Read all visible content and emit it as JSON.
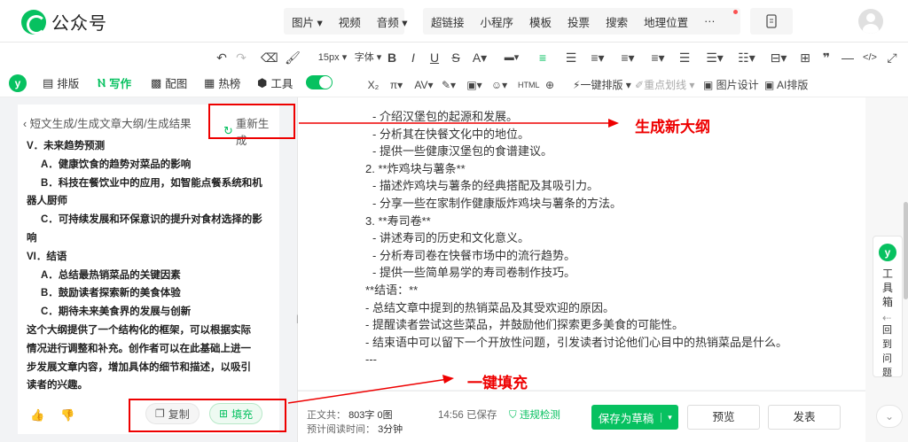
{
  "app": {
    "title": "公众号"
  },
  "topmenu": {
    "group1": [
      "图片",
      "视频",
      "音频"
    ],
    "group2": [
      "超链接",
      "小程序",
      "模板",
      "投票",
      "搜索",
      "地理位置",
      "···"
    ]
  },
  "toolbar": {
    "font_size": "15px",
    "font_family": "字体",
    "one_click": "一键排版",
    "highlight": "重点划线",
    "image_design": "图片设计",
    "ai_layout": "AI排版"
  },
  "nav": {
    "tabs": [
      {
        "label": "排版",
        "icon": "layout-icon"
      },
      {
        "label": "写作",
        "icon": "write-icon",
        "active": true
      },
      {
        "label": "配图",
        "icon": "image-icon"
      },
      {
        "label": "热榜",
        "icon": "hot-icon"
      },
      {
        "label": "工具",
        "icon": "tool-icon"
      }
    ]
  },
  "panel": {
    "breadcrumb": "短文生成/生成文章大纲/生成结果",
    "regenerate": "重新生成",
    "lines": [
      {
        "text": "V．未来趋势预测",
        "indent": false
      },
      {
        "text": "A．健康饮食的趋势对菜品的影响",
        "indent": true
      },
      {
        "text": "B．科技在餐饮业中的应用，如智能点餐系统和机",
        "indent": true
      },
      {
        "text": "器人厨师",
        "indent": false
      },
      {
        "text": "C．可持续发展和环保意识的提升对食材选择的影",
        "indent": true
      },
      {
        "text": "响",
        "indent": false
      },
      {
        "text": "VI．结语",
        "indent": false
      },
      {
        "text": "A．总结最热销菜品的关键因素",
        "indent": true
      },
      {
        "text": "B．鼓励读者探索新的美食体验",
        "indent": true
      },
      {
        "text": "C．期待未来美食界的发展与创新",
        "indent": true
      },
      {
        "text": "这个大纲提供了一个结构化的框架，可以根据实际",
        "indent": false
      },
      {
        "text": "情况进行调整和补充。创作者可以在此基础上进一",
        "indent": false
      },
      {
        "text": "步发展文章内容，增加具体的细节和描述，以吸引",
        "indent": false
      },
      {
        "text": "读者的兴趣。",
        "indent": false
      }
    ],
    "copy": "复制",
    "fill": "填充"
  },
  "document": {
    "lines": [
      {
        "text": "- 介绍汉堡包的起源和发展。",
        "indent": true
      },
      {
        "text": "- 分析其在快餐文化中的地位。",
        "indent": true
      },
      {
        "text": "- 提供一些健康汉堡包的食谱建议。",
        "indent": true
      },
      {
        "text": "2. **炸鸡块与薯条**",
        "indent": false
      },
      {
        "text": "- 描述炸鸡块与薯条的经典搭配及其吸引力。",
        "indent": true
      },
      {
        "text": "- 分享一些在家制作健康版炸鸡块与薯条的方法。",
        "indent": true
      },
      {
        "text": "3. **寿司卷**",
        "indent": false
      },
      {
        "text": "- 讲述寿司的历史和文化意义。",
        "indent": true
      },
      {
        "text": "- 分析寿司卷在快餐市场中的流行趋势。",
        "indent": true
      },
      {
        "text": "- 提供一些简单易学的寿司卷制作技巧。",
        "indent": true
      },
      {
        "text": "**结语：**",
        "indent": false
      },
      {
        "text": "- 总结文章中提到的热销菜品及其受欢迎的原因。",
        "indent": false
      },
      {
        "text": "- 提醒读者尝试这些菜品，并鼓励他们探索更多美食的可能性。",
        "indent": false
      },
      {
        "text": "- 结束语中可以留下一个开放性问题，引发读者讨论他们心目中的热销菜品是什么。",
        "indent": false
      },
      {
        "text": "---",
        "indent": false
      }
    ]
  },
  "footer": {
    "body_label": "正文共：",
    "word_count": "803字 0图",
    "read_label": "预计阅读时间：",
    "read_time": "3分钟",
    "saved": "14:56 已保存",
    "check": "违规检测",
    "save_draft": "保存为草稿",
    "preview": "预览",
    "publish": "发表"
  },
  "toolbox": {
    "label": "工具箱",
    "back_to": "回到问题"
  },
  "annotations": {
    "regen": "生成新大纲",
    "fill": "一键填充"
  },
  "colors": {
    "brand": "#07c160",
    "annotation": "#ee0000"
  }
}
